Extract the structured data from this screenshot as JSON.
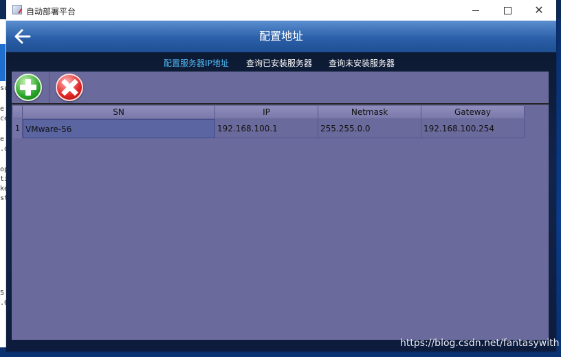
{
  "window": {
    "title": "自动部署平台"
  },
  "app": {
    "page_title": "配置地址"
  },
  "tabs": [
    {
      "label": "配置服务器IP地址",
      "active": true
    },
    {
      "label": "查询已安装服务器",
      "active": false
    },
    {
      "label": "查询未安装服务器",
      "active": false
    }
  ],
  "toolbar": {
    "add_icon": "plus-circle-icon",
    "delete_icon": "x-circle-icon"
  },
  "table": {
    "columns": [
      "SN",
      "IP",
      "Netmask",
      "Gateway"
    ],
    "rows": [
      {
        "num": "1",
        "sn": "VMware-56",
        "ip": "192.168.100.1",
        "netmask": "255.255.0.0",
        "gateway": "192.168.100.254"
      }
    ]
  },
  "watermark": "https://blog.csdn.net/fantasywith",
  "background_fragments": [
    "su",
    "e",
    "ce",
    "e",
    ".o",
    "op",
    "ti",
    "ke",
    "st",
    "5",
    ".0"
  ],
  "colors": {
    "accent_tab": "#4fb6f0",
    "panel": "#6b6a9c",
    "header_blue": "#2b5fa8"
  }
}
